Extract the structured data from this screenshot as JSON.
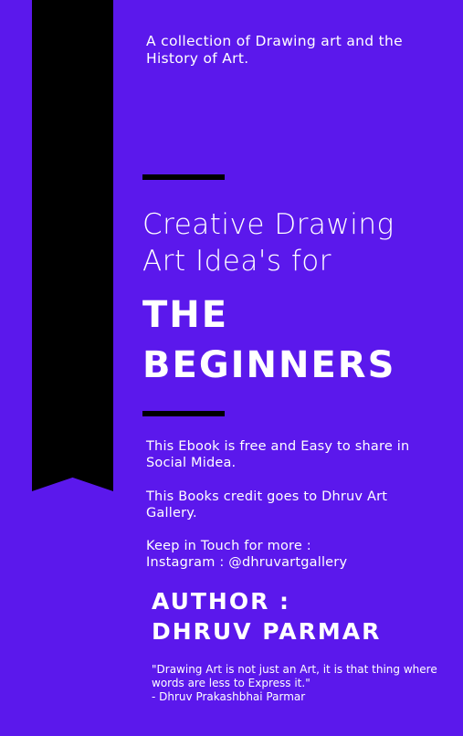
{
  "cover": {
    "tagline": "A collection of Drawing art and the History of Art.",
    "subtitle_line1": "Creative Drawing",
    "subtitle_line2": "Art Idea's for",
    "title_line1": "THE",
    "title_line2": "BEGINNERS",
    "info": [
      "This Ebook is free and Easy to share in Social Midea.",
      "This Books credit goes to Dhruv Art Gallery.",
      "Keep in Touch for more :",
      "Instagram : @dhruvartgallery"
    ],
    "author_label": "AUTHOR :",
    "author_name": "DHRUV PARMAR",
    "quote": "\"Drawing Art is not just an Art, it is that thing where words are less to Express it.\"",
    "quote_attribution": "- Dhruv Prakashbhai Parmar"
  },
  "colors": {
    "background": "#5b18ec",
    "ribbon": "#000000",
    "text": "#ffffff"
  }
}
